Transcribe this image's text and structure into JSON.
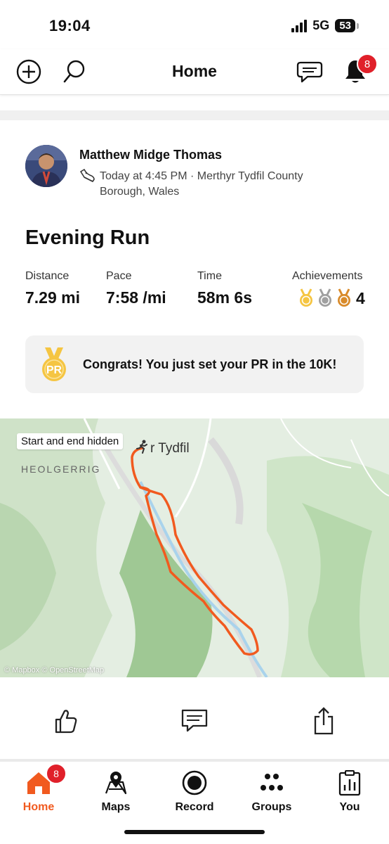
{
  "status": {
    "time": "19:04",
    "network": "5G",
    "battery": "53"
  },
  "header": {
    "title": "Home",
    "notification_count": "8"
  },
  "activity": {
    "athlete_name": "Matthew Midge Thomas",
    "meta": "Today at 4:45 PM · Merthyr Tydfil County Borough, Wales",
    "title": "Evening Run",
    "stats": [
      {
        "label": "Distance",
        "value": "7.29 mi"
      },
      {
        "label": "Pace",
        "value": "7:58 /mi"
      },
      {
        "label": "Time",
        "value": "58m 6s"
      }
    ],
    "achievements": {
      "label": "Achievements",
      "count": "4"
    },
    "pr": {
      "badge": "PR",
      "text": "Congrats! You just set your PR in the 10K!"
    }
  },
  "map": {
    "start_label": "Start and end hidden",
    "town_label": "r Tydfil",
    "area_label": "HEOLGERRIG",
    "attribution": "© Mapbox © OpenStreetMap",
    "route_color": "#f15a1f"
  },
  "tabs": [
    {
      "label": "Home",
      "badge": "8"
    },
    {
      "label": "Maps"
    },
    {
      "label": "Record"
    },
    {
      "label": "Groups"
    },
    {
      "label": "You"
    }
  ],
  "colors": {
    "accent": "#f15a1f",
    "badge": "#e0202a",
    "gold": "#f5c542",
    "silver": "#a0a0a0",
    "bronze": "#d98b2b"
  }
}
